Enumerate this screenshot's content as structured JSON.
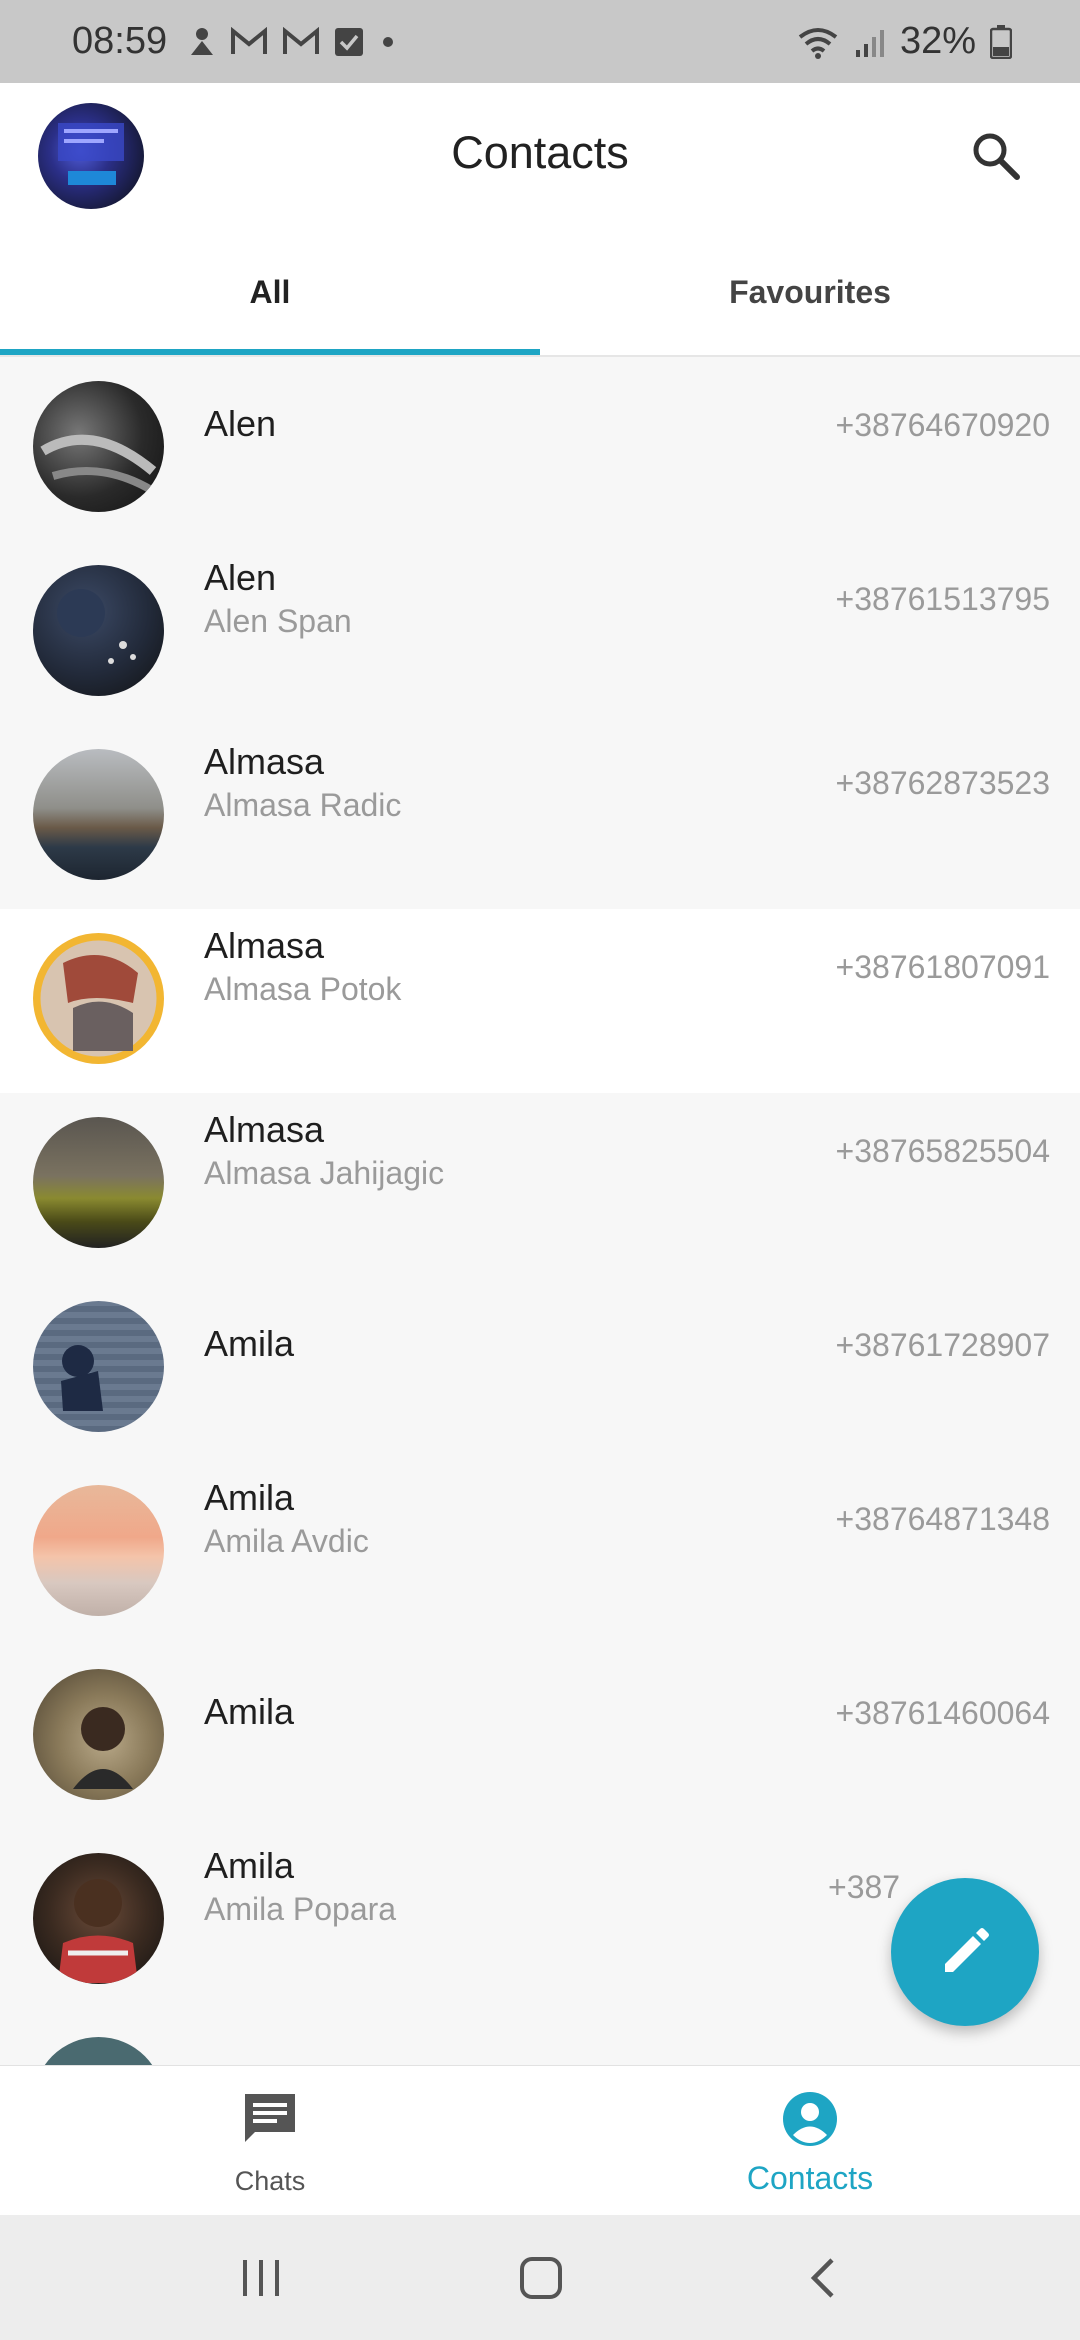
{
  "status_bar": {
    "time": "08:59",
    "battery": "32%",
    "left_icons": [
      "notification-icon",
      "gmail-icon",
      "gmail-icon",
      "checkbox-icon",
      "dot-icon"
    ],
    "right_icons": [
      "wifi-icon",
      "signal-icon",
      "battery-icon"
    ]
  },
  "app_bar": {
    "title": "Contacts",
    "search_icon": "search-icon"
  },
  "tabs": [
    {
      "label": "All",
      "selected": true
    },
    {
      "label": "Favourites",
      "selected": false
    }
  ],
  "contacts": [
    {
      "name": "Alen",
      "subname": "",
      "phone": "+38764670920",
      "highlight": false
    },
    {
      "name": "Alen",
      "subname": "Alen Span",
      "phone": "+38761513795",
      "highlight": false
    },
    {
      "name": "Almasa",
      "subname": "Almasa Radic",
      "phone": "+38762873523",
      "highlight": false
    },
    {
      "name": "Almasa",
      "subname": "Almasa Potok",
      "phone": "+38761807091",
      "highlight": true
    },
    {
      "name": "Almasa",
      "subname": "Almasa Jahijagic",
      "phone": "+38765825504",
      "highlight": false
    },
    {
      "name": "Amila",
      "subname": "",
      "phone": "+38761728907",
      "highlight": false
    },
    {
      "name": "Amila",
      "subname": "Amila Avdic",
      "phone": "+38764871348",
      "highlight": false
    },
    {
      "name": "Amila",
      "subname": "",
      "phone": "+38761460064",
      "highlight": false
    },
    {
      "name": "Amila",
      "subname": "Amila Popara",
      "phone": "+387",
      "highlight": false
    }
  ],
  "fab": {
    "icon": "pencil-icon"
  },
  "bottom_nav": {
    "chats": {
      "label": "Chats",
      "icon": "chat-icon"
    },
    "contacts": {
      "label": "Contacts",
      "icon": "account-circle-icon",
      "active": true
    }
  },
  "system_nav": [
    "recents-icon",
    "home-icon",
    "back-icon"
  ],
  "colors": {
    "accent": "#1ea5c4",
    "status_bar": "#c8c8c8",
    "list_bg": "#f7f7f7"
  }
}
